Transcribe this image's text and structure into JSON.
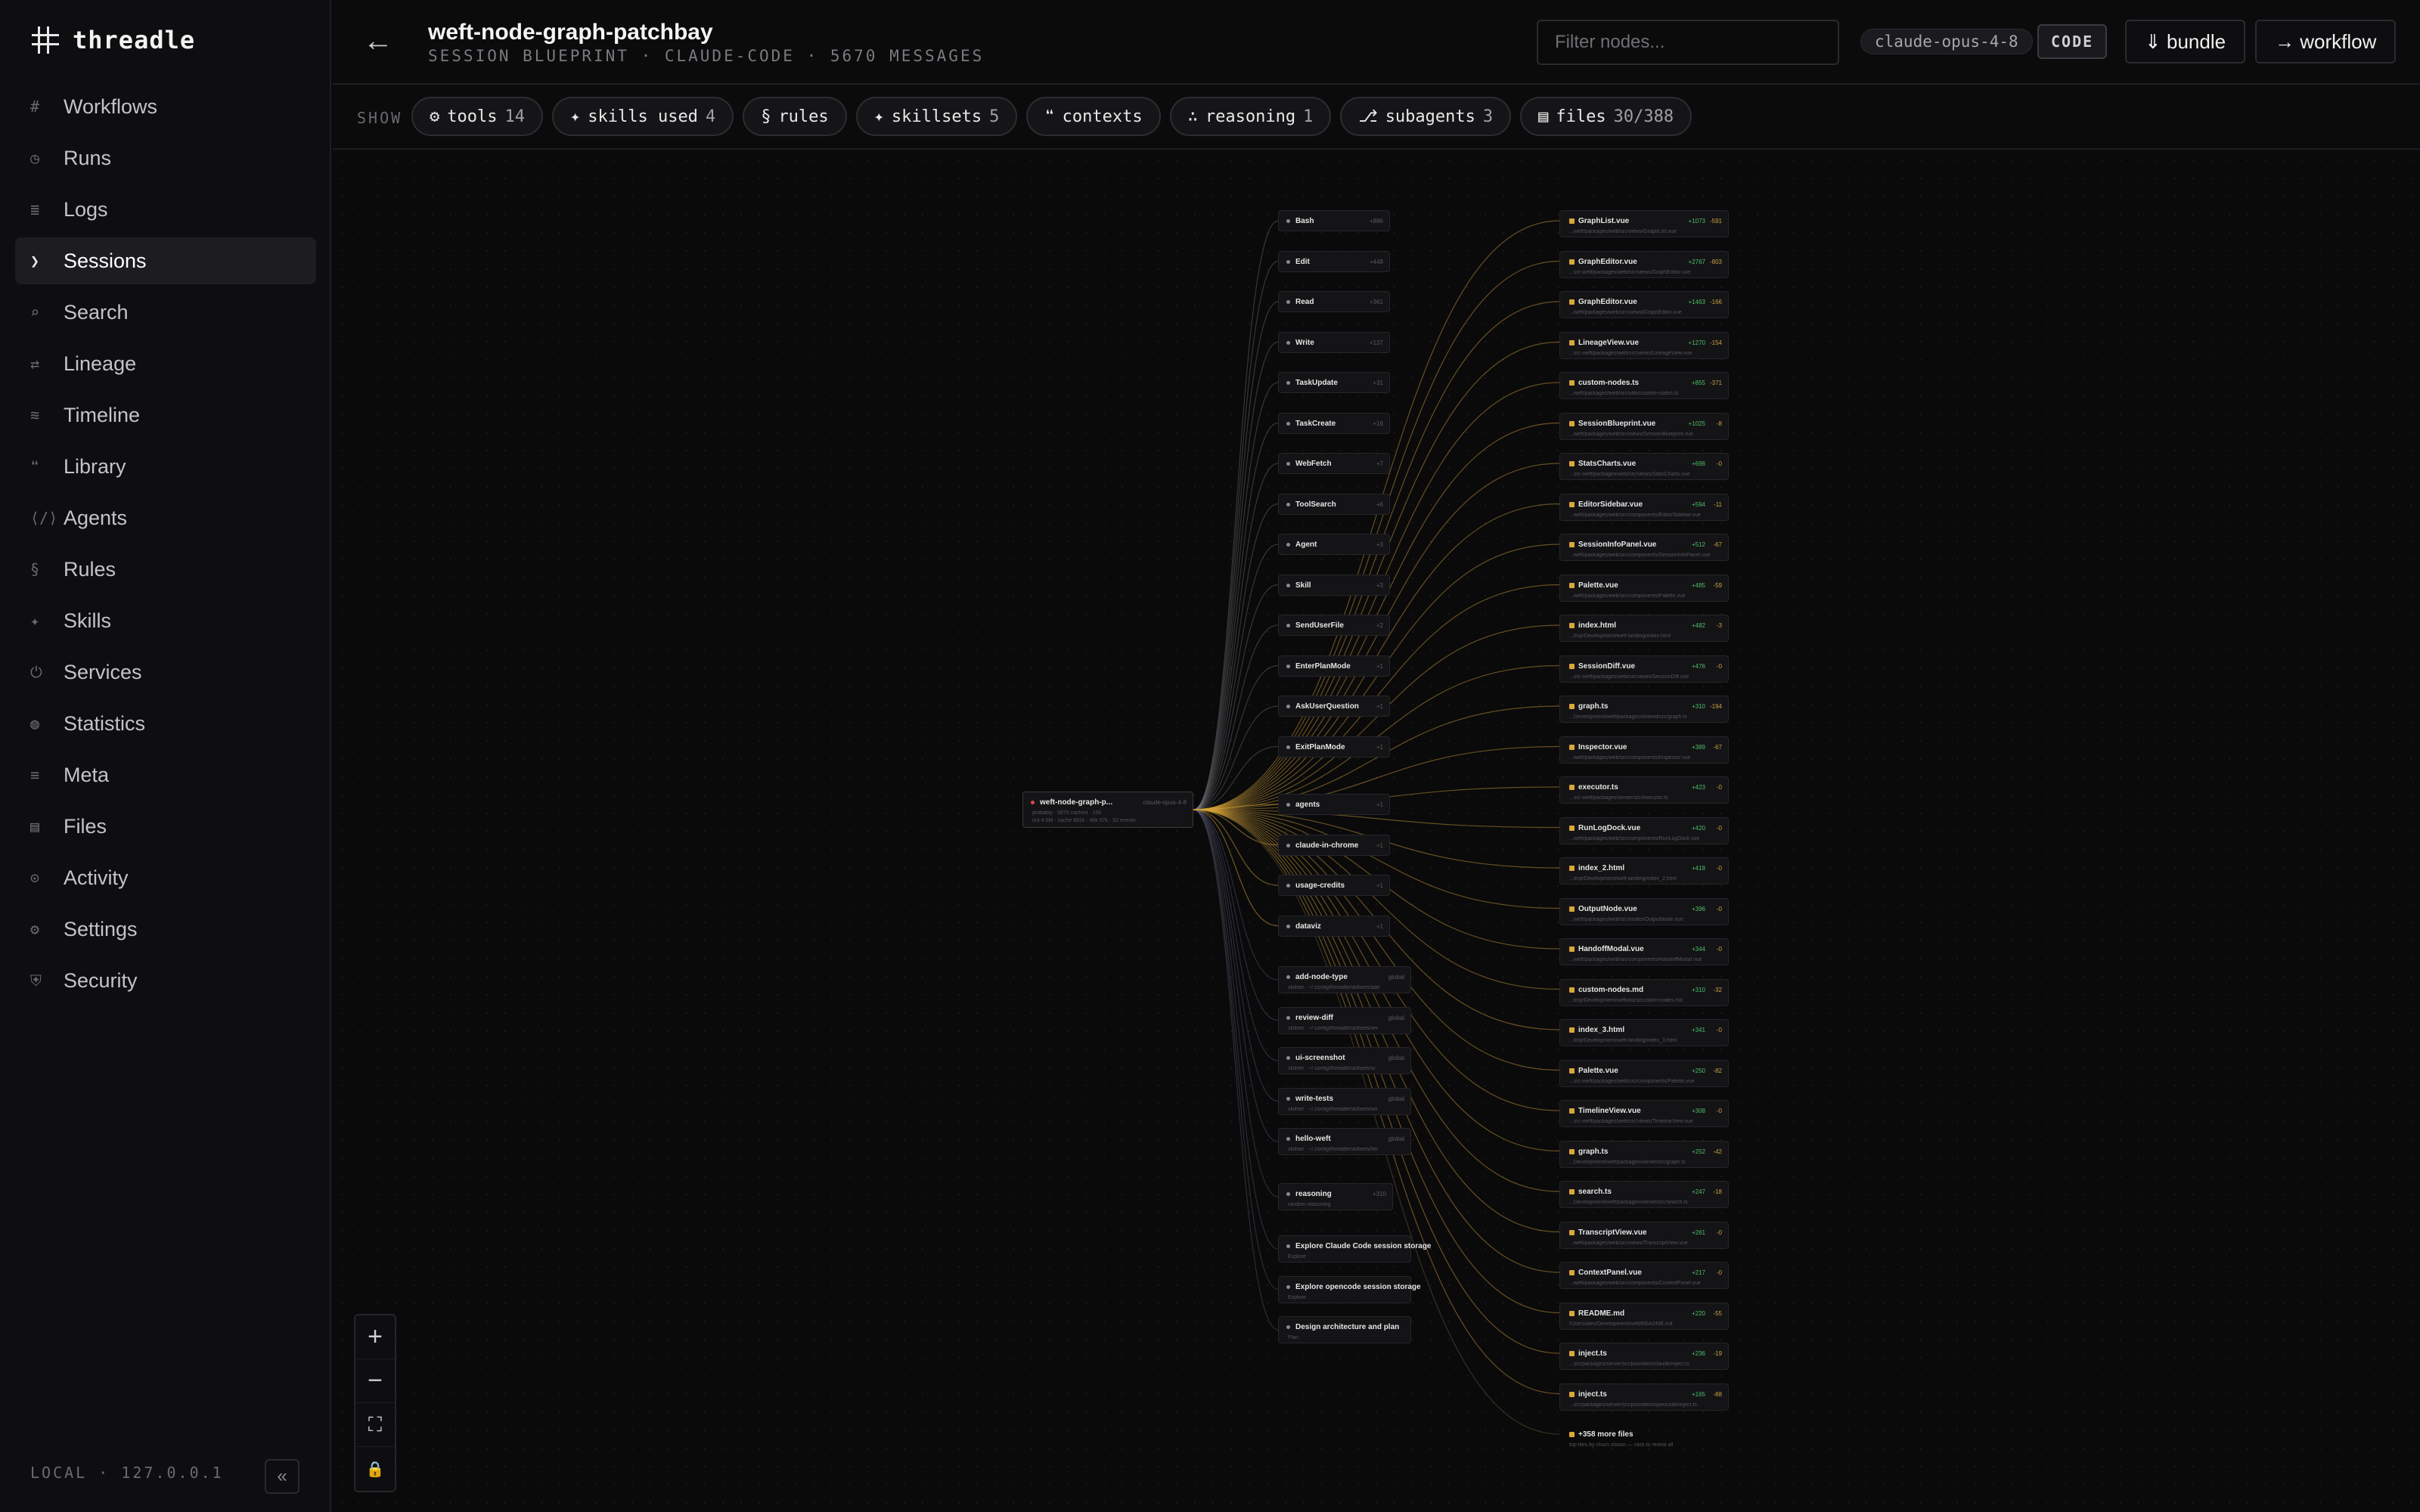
{
  "app": {
    "name": "threadle"
  },
  "sidebar": {
    "items": [
      {
        "icon": "#",
        "label": "Workflows",
        "name": "workflows"
      },
      {
        "icon": "◷",
        "label": "Runs",
        "name": "runs"
      },
      {
        "icon": "≣",
        "label": "Logs",
        "name": "logs"
      },
      {
        "icon": "❯",
        "label": "Sessions",
        "name": "sessions",
        "active": true
      },
      {
        "icon": "⌕",
        "label": "Search",
        "name": "search"
      },
      {
        "icon": "⇄",
        "label": "Lineage",
        "name": "lineage"
      },
      {
        "icon": "≋",
        "label": "Timeline",
        "name": "timeline"
      },
      {
        "icon": "❝",
        "label": "Library",
        "name": "library"
      },
      {
        "icon": "⟨/⟩",
        "label": "Agents",
        "name": "agents"
      },
      {
        "icon": "§",
        "label": "Rules",
        "name": "rules"
      },
      {
        "icon": "✦",
        "label": "Skills",
        "name": "skills"
      },
      {
        "icon": "⏻",
        "label": "Services",
        "name": "services"
      },
      {
        "icon": "◍",
        "label": "Statistics",
        "name": "statistics"
      },
      {
        "icon": "≡",
        "label": "Meta",
        "name": "meta"
      },
      {
        "icon": "▤",
        "label": "Files",
        "name": "files"
      },
      {
        "icon": "⊙",
        "label": "Activity",
        "name": "activity"
      },
      {
        "icon": "⚙",
        "label": "Settings",
        "name": "settings"
      },
      {
        "icon": "⛨",
        "label": "Security",
        "name": "security"
      }
    ],
    "footer": "LOCAL · 127.0.0.1",
    "collapse_label": "«"
  },
  "header": {
    "back_label": "←",
    "title": "weft-node-graph-patchbay",
    "subtitle": "SESSION BLUEPRINT · CLAUDE-CODE · 5670 MESSAGES",
    "filter_placeholder": "Filter nodes...",
    "model": "claude-opus-4-8",
    "code_label": "CODE",
    "bundle_label": "⇓ bundle",
    "workflow_label": "→ workflow"
  },
  "showbar": {
    "label": "SHOW",
    "pills": [
      {
        "name": "tools",
        "icon": "⚙",
        "label": "tools",
        "count": "14"
      },
      {
        "name": "skills-used",
        "icon": "✦",
        "label": "skills used",
        "count": "4"
      },
      {
        "name": "rules",
        "icon": "§",
        "label": "rules",
        "count": ""
      },
      {
        "name": "skillsets",
        "icon": "✦",
        "label": "skillsets",
        "count": "5"
      },
      {
        "name": "contexts",
        "icon": "❝",
        "label": "contexts",
        "count": ""
      },
      {
        "name": "reasoning",
        "icon": "∴",
        "label": "reasoning",
        "count": "1"
      },
      {
        "name": "subagents",
        "icon": "⎇",
        "label": "subagents",
        "count": "3"
      },
      {
        "name": "files",
        "icon": "▤",
        "label": "files",
        "count": "30/388"
      }
    ]
  },
  "graph": {
    "root": {
      "title": "weft-node-graph-p...",
      "badge": "claude-opus-4-8",
      "line1": "probably · 5670 cached · 158",
      "line2": "out 4.0M · cache 891k · 40k 57k · 52 events"
    },
    "tools": [
      {
        "label": "Bash",
        "count": "+886"
      },
      {
        "label": "Edit",
        "count": "+448"
      },
      {
        "label": "Read",
        "count": "+361"
      },
      {
        "label": "Write",
        "count": "+137"
      },
      {
        "label": "TaskUpdate",
        "count": "+31"
      },
      {
        "label": "TaskCreate",
        "count": "+16"
      },
      {
        "label": "WebFetch",
        "count": "+7"
      },
      {
        "label": "ToolSearch",
        "count": "+6"
      },
      {
        "label": "Agent",
        "count": "+3"
      },
      {
        "label": "Skill",
        "count": "+3"
      },
      {
        "label": "SendUserFile",
        "count": "+2"
      },
      {
        "label": "EnterPlanMode",
        "count": "+1"
      },
      {
        "label": "AskUserQuestion",
        "count": "+1"
      },
      {
        "label": "ExitPlanMode",
        "count": "+1"
      }
    ],
    "skills": [
      {
        "label": "agents",
        "count": "+1"
      },
      {
        "label": "claude-in-chrome",
        "count": "+1"
      },
      {
        "label": "usage-credits",
        "count": "+1"
      },
      {
        "label": "dataviz",
        "count": "+1"
      }
    ],
    "skillsets": [
      {
        "label": "add-node-type",
        "tag": "global",
        "sub": "skillset · ~/.config/threadle/skillsets/add"
      },
      {
        "label": "review-diff",
        "tag": "global",
        "sub": "skillset · ~/.config/threadle/skillsets/rev"
      },
      {
        "label": "ui-screenshot",
        "tag": "global",
        "sub": "skillset · ~/.config/threadle/skillsets/ui-"
      },
      {
        "label": "write-tests",
        "tag": "global",
        "sub": "skillset · ~/.config/threadle/skillsets/wri"
      },
      {
        "label": "hello-weft",
        "tag": "global",
        "sub": "skillset · ~/.config/threadle/skillsets/hel"
      }
    ],
    "reasoning": {
      "label": "reasoning",
      "count": "+310",
      "sub": "random reasoning"
    },
    "subagents": [
      {
        "label": "Explore Claude Code session storage",
        "sub": "Explore"
      },
      {
        "label": "Explore opencode session storage",
        "sub": "Explore"
      },
      {
        "label": "Design architecture and plan",
        "sub": "Plan"
      }
    ],
    "files": [
      {
        "label": "GraphList.vue",
        "add": "+1073",
        "del": "-591",
        "path": "...weft/packages/web/src/views/GraphList.vue"
      },
      {
        "label": "GraphEditor.vue",
        "add": "+2767",
        "del": "-803",
        "path": "...src-weft/packages/web/src/views/GraphEditor.vue"
      },
      {
        "label": "GraphEditor.vue",
        "add": "+1463",
        "del": "-166",
        "path": "...weft/packages/web/src/views/GraphEditor.vue"
      },
      {
        "label": "LineageView.vue",
        "add": "+1270",
        "del": "-154",
        "path": "...src-weft/packages/web/src/views/LineageView.vue"
      },
      {
        "label": "custom-nodes.ts",
        "add": "+855",
        "del": "-371",
        "path": "...weft/packages/web/src/utils/custom-nodes.ts"
      },
      {
        "label": "SessionBlueprint.vue",
        "add": "+1025",
        "del": "-8",
        "path": "...weft/packages/web/src/views/SessionBlueprint.vue"
      },
      {
        "label": "StatsCharts.vue",
        "add": "+696",
        "del": "-0",
        "path": "...src-weft/packages/web/src/views/StatsCharts.vue"
      },
      {
        "label": "EditorSidebar.vue",
        "add": "+594",
        "del": "-11",
        "path": "...weft/packages/web/src/components/EditorSidebar.vue"
      },
      {
        "label": "SessionInfoPanel.vue",
        "add": "+512",
        "del": "-67",
        "path": "...weft/packages/web/src/components/SessionInfoPanel.vue"
      },
      {
        "label": "Palette.vue",
        "add": "+485",
        "del": "-59",
        "path": "...weft/packages/web/src/components/Palette.vue"
      },
      {
        "label": "index.html",
        "add": "+482",
        "del": "-3",
        "path": "...tmp/Development/weft-landing/index.html"
      },
      {
        "label": "SessionDiff.vue",
        "add": "+476",
        "del": "-0",
        "path": "...src-weft/packages/web/src/views/SessionDiff.vue"
      },
      {
        "label": "graph.ts",
        "add": "+310",
        "del": "-194",
        "path": "...Development/weft/packages/shared/src/graph.ts"
      },
      {
        "label": "Inspector.vue",
        "add": "+389",
        "del": "-67",
        "path": "...weft/packages/web/src/components/Inspector.vue"
      },
      {
        "label": "executor.ts",
        "add": "+423",
        "del": "-0",
        "path": "...src-weft/packages/server/src/executor.ts"
      },
      {
        "label": "RunLogDock.vue",
        "add": "+420",
        "del": "-0",
        "path": "...weft/packages/web/src/components/RunLogDock.vue"
      },
      {
        "label": "index_2.html",
        "add": "+418",
        "del": "-0",
        "path": "...tmp/Development/weft-landing/index_2.html"
      },
      {
        "label": "OutputNode.vue",
        "add": "+396",
        "del": "-0",
        "path": "...weft/packages/web/src/nodes/OutputNode.vue"
      },
      {
        "label": "HandoffModal.vue",
        "add": "+344",
        "del": "-0",
        "path": "...weft/packages/web/src/components/HandoffModal.vue"
      },
      {
        "label": "custom-nodes.md",
        "add": "+310",
        "del": "-32",
        "path": "...tmp/Development/weft/docs/custom-nodes.md"
      },
      {
        "label": "index_3.html",
        "add": "+341",
        "del": "-0",
        "path": "...tmp/Development/weft-landing/index_3.html"
      },
      {
        "label": "Palette.vue",
        "add": "+250",
        "del": "-82",
        "path": "...src-weft/packages/web/src/components/Palette.vue"
      },
      {
        "label": "TimelineView.vue",
        "add": "+308",
        "del": "-0",
        "path": "...src-weft/packages/web/src/views/TimelineView.vue"
      },
      {
        "label": "graph.ts",
        "add": "+252",
        "del": "-42",
        "path": "...Development/weft/packages/server/src/graph.ts"
      },
      {
        "label": "search.ts",
        "add": "+247",
        "del": "-18",
        "path": "...Development/weft/packages/server/src/search.ts"
      },
      {
        "label": "TranscriptView.vue",
        "add": "+261",
        "del": "-0",
        "path": "...weft/packages/web/src/views/TranscriptView.vue"
      },
      {
        "label": "ContextPanel.vue",
        "add": "+217",
        "del": "-0",
        "path": "...weft/packages/web/src/components/ContextPanel.vue"
      },
      {
        "label": "README.md",
        "add": "+220",
        "del": "-55",
        "path": "/Users/alex/Development/weft/README.md"
      },
      {
        "label": "inject.ts",
        "add": "+236",
        "del": "-19",
        "path": "...src/packages/server/src/providers/claude/inject.ts"
      },
      {
        "label": "inject.ts",
        "add": "+165",
        "del": "-88",
        "path": "...src/packages/server/src/providers/opencode/inject.ts"
      }
    ],
    "more_files": {
      "label": "+358 more files",
      "sub": "top files by churn shown — click to reveal all"
    }
  },
  "zoom": {
    "in": "+",
    "out": "−",
    "fit": "⛶",
    "lock": "🔒"
  },
  "colors": {
    "accent": "#d9a73a",
    "add": "#4fbf6a",
    "background": "#0a0a0b"
  }
}
